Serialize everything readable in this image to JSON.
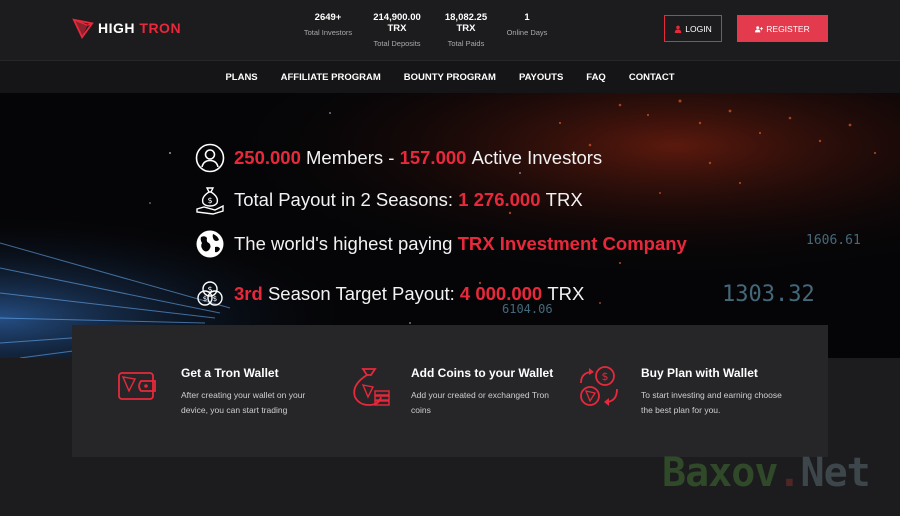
{
  "brand": {
    "name_part1": "HIGH",
    "name_part2": "TRON",
    "accent_color": "#e8283b",
    "logo_icon": "tron-logo-icon"
  },
  "stats": [
    {
      "value": "2649+",
      "label": "Total Investors"
    },
    {
      "value": "214,900.00 TRX",
      "label": "Total Deposits"
    },
    {
      "value": "18,082.25 TRX",
      "label": "Total Paids"
    },
    {
      "value": "1",
      "label": "Online Days"
    }
  ],
  "auth": {
    "login_label": "LOGIN",
    "register_label": "REGISTER",
    "login_icon": "user-icon",
    "register_icon": "user-plus-icon"
  },
  "nav": {
    "items": [
      "PLANS",
      "AFFILIATE PROGRAM",
      "BOUNTY PROGRAM",
      "PAYOUTS",
      "FAQ",
      "CONTACT"
    ]
  },
  "hero": {
    "line1": {
      "members": "250.000",
      "members_text": "Members -",
      "active": "157.000",
      "active_text": "Active Investors"
    },
    "line2": {
      "text": "Total Payout in 2 Seasons:",
      "amount": "1 276.000",
      "unit": "TRX"
    },
    "line3": {
      "text": "The world's highest paying",
      "highlight": "TRX Investment Company"
    },
    "line4": {
      "season": "3rd",
      "text": "Season Target Payout:",
      "amount": "4 000.000",
      "unit": "TRX"
    },
    "deco_numbers": [
      "1606.61",
      "1303.32",
      "6104.06"
    ]
  },
  "steps": [
    {
      "title": "Get a Tron Wallet",
      "desc": "After creating your wallet on your device, you can start trading",
      "icon": "wallet-icon"
    },
    {
      "title": "Add Coins to your Wallet",
      "desc": "Add your created or exchanged Tron coins",
      "icon": "money-bag-icon"
    },
    {
      "title": "Buy Plan with Wallet",
      "desc": "To start investing and earning choose the best plan for you.",
      "icon": "exchange-coins-icon"
    }
  ],
  "watermark": {
    "part1": "Baxov",
    "part2": ".",
    "part3": "Net"
  }
}
